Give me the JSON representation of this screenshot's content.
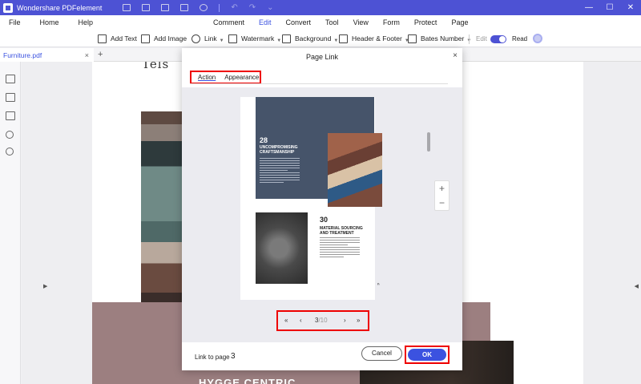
{
  "app": {
    "name": "Wondershare PDFelement"
  },
  "menu_left": [
    "File",
    "Home",
    "Help"
  ],
  "menu_center": [
    "Comment",
    "Edit",
    "Convert",
    "Tool",
    "View",
    "Form",
    "Protect",
    "Page"
  ],
  "menu_active": "Edit",
  "toolbar": {
    "add_text": "Add Text",
    "add_image": "Add Image",
    "link": "Link",
    "watermark": "Watermark",
    "background": "Background",
    "header_footer": "Header & Footer",
    "bates_number": "Bates Number",
    "edit_mode": "Edit",
    "read_mode": "Read"
  },
  "tab": {
    "filename": "Furniture.pdf",
    "close": "×",
    "add": "+"
  },
  "document": {
    "bottom_heading": "HYGGE CENTRIC"
  },
  "dialog": {
    "title": "Page Link",
    "close": "×",
    "tabs": [
      "Action",
      "Appearance"
    ],
    "preview": {
      "num1": "28",
      "heading1": "UNCOMPROMISING CRAFTSMANSHIP",
      "num2": "30",
      "heading2": "MATERIAL SOURCING AND TREATMENT"
    },
    "zoom": {
      "plus": "+",
      "minus": "−"
    },
    "pager": {
      "first": "«",
      "prev": "‹",
      "current": "3",
      "total": "/10",
      "next": "›",
      "last": "»"
    },
    "link_to_page_label": "Link to page",
    "link_to_page_value": "3",
    "cancel": "Cancel",
    "ok": "OK"
  },
  "colors": {
    "brand": "#4d52d4",
    "accent": "#3b52e0",
    "highlight": "#ee0000"
  }
}
